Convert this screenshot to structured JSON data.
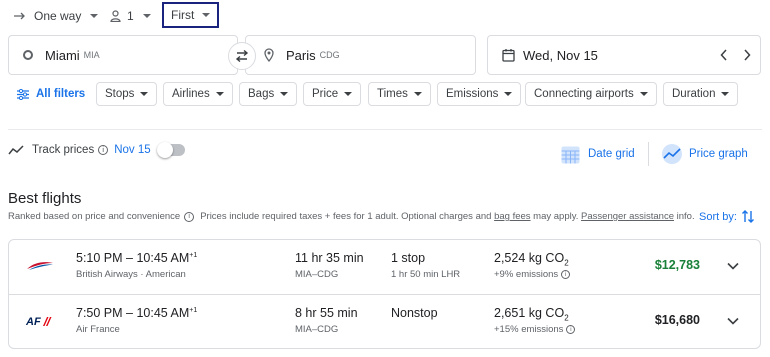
{
  "trip_type": {
    "label": "One way"
  },
  "passengers": {
    "count": "1"
  },
  "cabin": {
    "label": "First"
  },
  "origin": {
    "city": "Miami",
    "code": "MIA"
  },
  "destination": {
    "city": "Paris",
    "code": "CDG"
  },
  "date": {
    "label": "Wed, Nov 15"
  },
  "filters": {
    "all_label": "All filters",
    "chips": [
      "Stops",
      "Airlines",
      "Bags",
      "Price",
      "Times",
      "Emissions",
      "Connecting airports",
      "Duration"
    ]
  },
  "track": {
    "label": "Track prices",
    "date": "Nov 15"
  },
  "views": {
    "date_grid": "Date grid",
    "price_graph": "Price graph"
  },
  "best": {
    "title": "Best flights",
    "ranked": "Ranked based on price and convenience",
    "includes": "Prices include required taxes + fees for 1 adult. Optional charges and",
    "bag_fees": "bag fees",
    "may_apply": "may apply.",
    "assist": "Passenger assistance",
    "info": "info.",
    "sort_label": "Sort by:"
  },
  "flights": [
    {
      "depart": "5:10 PM",
      "arrive": "10:45 AM",
      "day_offset": "+1",
      "airline": "British Airways · American",
      "duration": "11 hr 35 min",
      "route": "MIA–CDG",
      "stops": "1 stop",
      "layover": "1 hr 50 min LHR",
      "emissions_value": "2,524 kg CO",
      "emissions_sub": "2",
      "emissions_delta": "+9% emissions",
      "price": "$12,783",
      "price_color": "#188038",
      "logo": "british-airways-logo"
    },
    {
      "depart": "7:50 PM",
      "arrive": "10:45 AM",
      "day_offset": "+1",
      "airline": "Air France",
      "duration": "8 hr 55 min",
      "route": "MIA–CDG",
      "stops": "Nonstop",
      "layover": "",
      "emissions_value": "2,651 kg CO",
      "emissions_sub": "2",
      "emissions_delta": "+15% emissions",
      "price": "$16,680",
      "price_color": "#202124",
      "logo": "air-france-logo"
    }
  ],
  "colors": {
    "accent": "#1a73e8",
    "cabin_highlight": "#1a237e",
    "good_price": "#188038"
  }
}
